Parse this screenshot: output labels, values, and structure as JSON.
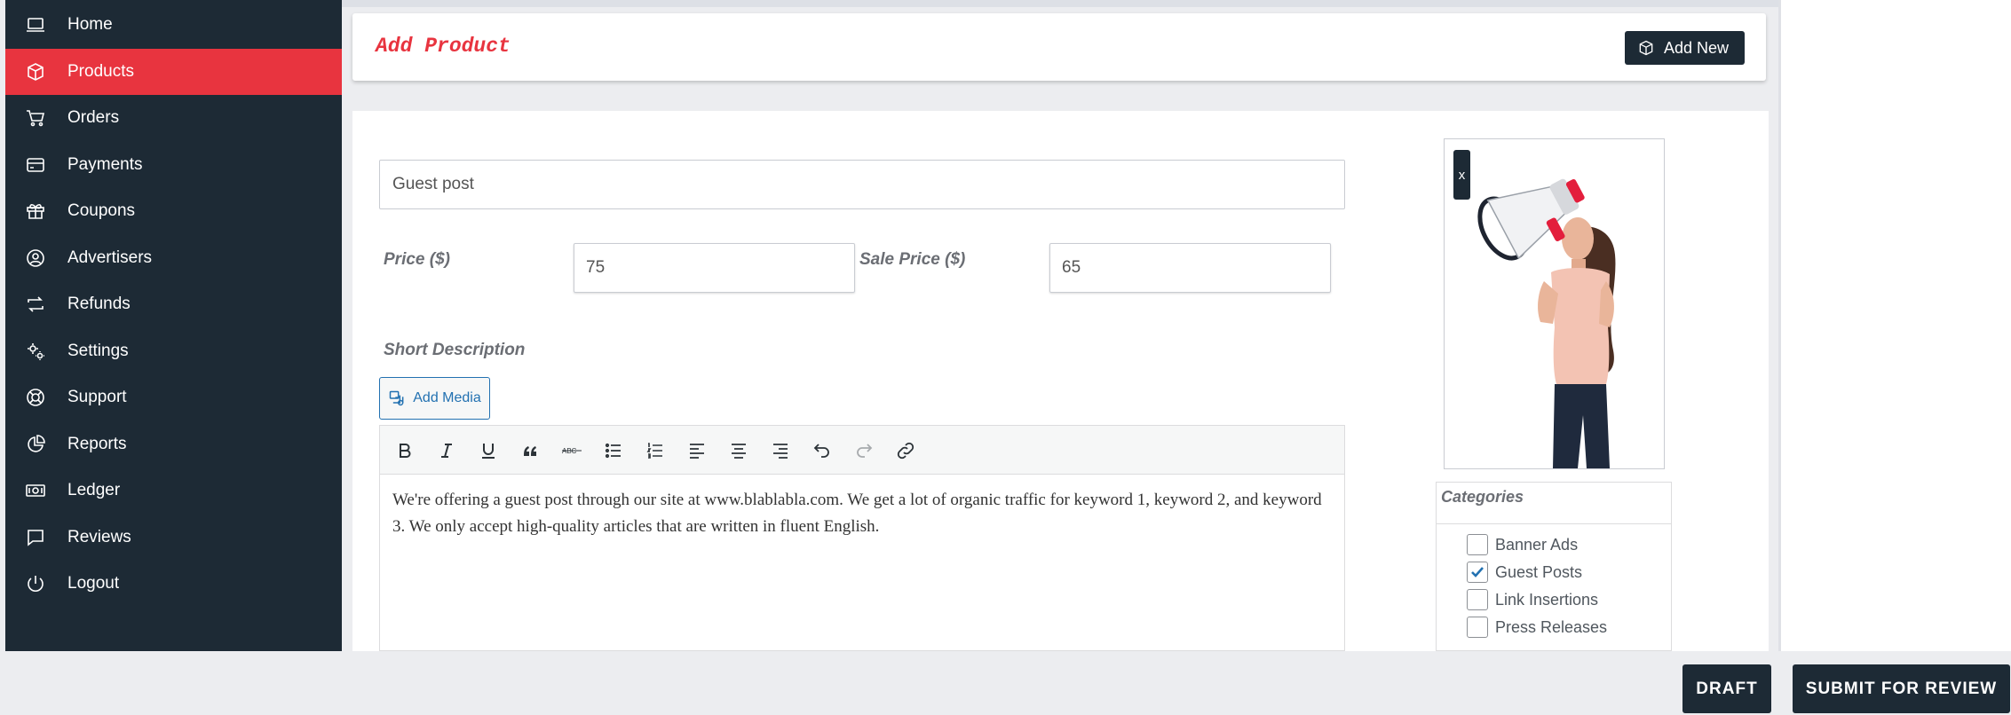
{
  "sidebar": {
    "items": [
      {
        "label": "Home",
        "icon": "laptop-icon"
      },
      {
        "label": "Products",
        "icon": "box-icon",
        "active": true
      },
      {
        "label": "Orders",
        "icon": "cart-icon"
      },
      {
        "label": "Payments",
        "icon": "credit-card-icon"
      },
      {
        "label": "Coupons",
        "icon": "gift-icon"
      },
      {
        "label": "Advertisers",
        "icon": "user-circle-icon"
      },
      {
        "label": "Refunds",
        "icon": "repeat-icon"
      },
      {
        "label": "Settings",
        "icon": "gears-icon"
      },
      {
        "label": "Support",
        "icon": "lifebuoy-icon"
      },
      {
        "label": "Reports",
        "icon": "chart-pie-icon"
      },
      {
        "label": "Ledger",
        "icon": "money-icon"
      },
      {
        "label": "Reviews",
        "icon": "comment-icon"
      },
      {
        "label": "Logout",
        "icon": "power-icon"
      }
    ]
  },
  "header": {
    "title": "Add Product",
    "add_new_label": "Add New"
  },
  "form": {
    "product_title": "Guest post",
    "price_label": "Price ($)",
    "price_value": "75",
    "sale_price_label": "Sale Price ($)",
    "sale_price_value": "65",
    "short_description_label": "Short Description",
    "add_media_label": "Add Media",
    "description_text": "We're offering a guest post through our site at www.blablabla.com. We get a lot of organic traffic for keyword 1, keyword 2, and keyword 3. We only accept high-quality articles that are written in fluent English."
  },
  "image": {
    "remove_label": "x"
  },
  "categories": {
    "title": "Categories",
    "items": [
      {
        "label": "Banner Ads",
        "checked": false
      },
      {
        "label": "Guest Posts",
        "checked": true
      },
      {
        "label": "Link Insertions",
        "checked": false
      },
      {
        "label": "Press Releases",
        "checked": false
      }
    ]
  },
  "footer": {
    "draft_label": "DRAFT",
    "submit_label": "SUBMIT FOR REVIEW"
  },
  "colors": {
    "sidebar_bg": "#1d2a35",
    "accent_red": "#e8343f",
    "link_blue": "#2271b1"
  }
}
